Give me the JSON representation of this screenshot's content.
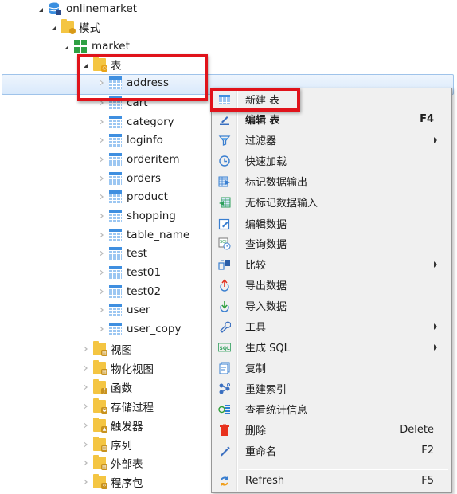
{
  "tree": {
    "connection": {
      "label": "onlinemarket",
      "icon": "database-icon"
    },
    "schema_group": {
      "label": "模式",
      "icon": "schema-folder-icon"
    },
    "schema": {
      "label": "market",
      "icon": "schema-icon"
    },
    "tables_folder": {
      "label": "表",
      "icon": "tables-folder-icon"
    },
    "tables": [
      {
        "label": "address",
        "selected": true
      },
      {
        "label": "cart"
      },
      {
        "label": "category"
      },
      {
        "label": "loginfo"
      },
      {
        "label": "orderitem"
      },
      {
        "label": "orders"
      },
      {
        "label": "product"
      },
      {
        "label": "shopping"
      },
      {
        "label": "table_name"
      },
      {
        "label": "test"
      },
      {
        "label": "test01"
      },
      {
        "label": "test02"
      },
      {
        "label": "user"
      },
      {
        "label": "user_copy"
      }
    ],
    "other_folders": [
      {
        "label": "视图",
        "icon": "views-folder-icon",
        "badge_color": "#c8921e"
      },
      {
        "label": "物化视图",
        "icon": "materialized-views-folder-icon",
        "badge_color": "#c8921e"
      },
      {
        "label": "函数",
        "icon": "functions-folder-icon",
        "badge_color": "#c8921e"
      },
      {
        "label": "存储过程",
        "icon": "procedures-folder-icon",
        "badge_color": "#c8921e"
      },
      {
        "label": "触发器",
        "icon": "triggers-folder-icon",
        "badge_color": "#c8921e"
      },
      {
        "label": "序列",
        "icon": "sequences-folder-icon",
        "badge_color": "#c8921e"
      },
      {
        "label": "外部表",
        "icon": "external-tables-folder-icon",
        "badge_color": "#c8921e"
      },
      {
        "label": "程序包",
        "icon": "packages-folder-icon",
        "badge_color": "#c8921e"
      }
    ]
  },
  "context_menu": {
    "items": [
      {
        "label": "新建 表",
        "icon": "new-table-icon",
        "shortcut": "",
        "submenu": false,
        "bold": false,
        "highlighted": true
      },
      {
        "label": "编辑 表",
        "icon": "edit-icon",
        "shortcut": "F4",
        "submenu": false,
        "bold": true
      },
      {
        "label": "过滤器",
        "icon": "filter-icon",
        "shortcut": "",
        "submenu": true
      },
      {
        "label": "快速加载",
        "icon": "quick-load-icon",
        "shortcut": "",
        "submenu": false
      },
      {
        "label": "标记数据输出",
        "icon": "export-marked-data-icon",
        "shortcut": "",
        "submenu": false
      },
      {
        "label": "无标记数据输入",
        "icon": "import-unmarked-data-icon",
        "shortcut": "",
        "submenu": false
      },
      {
        "label": "编辑数据",
        "icon": "edit-data-icon",
        "shortcut": "",
        "submenu": false
      },
      {
        "label": "查询数据",
        "icon": "query-data-icon",
        "shortcut": "",
        "submenu": false
      },
      {
        "label": "比较",
        "icon": "compare-icon",
        "shortcut": "",
        "submenu": true
      },
      {
        "label": "导出数据",
        "icon": "export-data-icon",
        "shortcut": "",
        "submenu": false
      },
      {
        "label": "导入数据",
        "icon": "import-data-icon",
        "shortcut": "",
        "submenu": false
      },
      {
        "label": "工具",
        "icon": "wrench-icon",
        "shortcut": "",
        "submenu": true
      },
      {
        "label": "生成 SQL",
        "icon": "sql-icon",
        "shortcut": "",
        "submenu": true
      },
      {
        "label": "复制",
        "icon": "copy-icon",
        "shortcut": "",
        "submenu": false
      },
      {
        "label": "重建索引",
        "icon": "rebuild-index-icon",
        "shortcut": "",
        "submenu": false
      },
      {
        "label": "查看统计信息",
        "icon": "statistics-icon",
        "shortcut": "",
        "submenu": false
      },
      {
        "label": "删除",
        "icon": "trash-icon",
        "shortcut": "Delete",
        "submenu": false
      },
      {
        "label": "重命名",
        "icon": "rename-icon",
        "shortcut": "F2",
        "submenu": false
      }
    ],
    "footer_item": {
      "label": "Refresh",
      "icon": "refresh-icon",
      "shortcut": "F5"
    }
  },
  "colors": {
    "highlight_box": "#e0131b",
    "selection_border": "#9fc3ea",
    "table_icon_blue": "#3f8fe0",
    "folder_yellow": "#f4c542",
    "delete_red": "#e8321d"
  }
}
